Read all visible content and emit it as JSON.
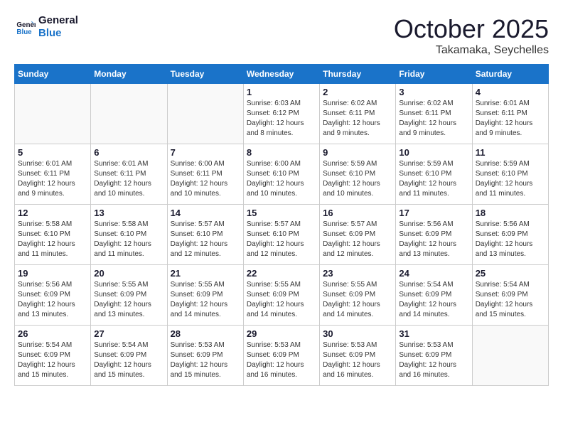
{
  "header": {
    "logo_text_general": "General",
    "logo_text_blue": "Blue",
    "month": "October 2025",
    "location": "Takamaka, Seychelles"
  },
  "weekdays": [
    "Sunday",
    "Monday",
    "Tuesday",
    "Wednesday",
    "Thursday",
    "Friday",
    "Saturday"
  ],
  "weeks": [
    [
      {
        "day": "",
        "sunrise": "",
        "sunset": "",
        "daylight": ""
      },
      {
        "day": "",
        "sunrise": "",
        "sunset": "",
        "daylight": ""
      },
      {
        "day": "",
        "sunrise": "",
        "sunset": "",
        "daylight": ""
      },
      {
        "day": "1",
        "sunrise": "Sunrise: 6:03 AM",
        "sunset": "Sunset: 6:12 PM",
        "daylight": "Daylight: 12 hours and 8 minutes."
      },
      {
        "day": "2",
        "sunrise": "Sunrise: 6:02 AM",
        "sunset": "Sunset: 6:11 PM",
        "daylight": "Daylight: 12 hours and 9 minutes."
      },
      {
        "day": "3",
        "sunrise": "Sunrise: 6:02 AM",
        "sunset": "Sunset: 6:11 PM",
        "daylight": "Daylight: 12 hours and 9 minutes."
      },
      {
        "day": "4",
        "sunrise": "Sunrise: 6:01 AM",
        "sunset": "Sunset: 6:11 PM",
        "daylight": "Daylight: 12 hours and 9 minutes."
      }
    ],
    [
      {
        "day": "5",
        "sunrise": "Sunrise: 6:01 AM",
        "sunset": "Sunset: 6:11 PM",
        "daylight": "Daylight: 12 hours and 9 minutes."
      },
      {
        "day": "6",
        "sunrise": "Sunrise: 6:01 AM",
        "sunset": "Sunset: 6:11 PM",
        "daylight": "Daylight: 12 hours and 10 minutes."
      },
      {
        "day": "7",
        "sunrise": "Sunrise: 6:00 AM",
        "sunset": "Sunset: 6:11 PM",
        "daylight": "Daylight: 12 hours and 10 minutes."
      },
      {
        "day": "8",
        "sunrise": "Sunrise: 6:00 AM",
        "sunset": "Sunset: 6:10 PM",
        "daylight": "Daylight: 12 hours and 10 minutes."
      },
      {
        "day": "9",
        "sunrise": "Sunrise: 5:59 AM",
        "sunset": "Sunset: 6:10 PM",
        "daylight": "Daylight: 12 hours and 10 minutes."
      },
      {
        "day": "10",
        "sunrise": "Sunrise: 5:59 AM",
        "sunset": "Sunset: 6:10 PM",
        "daylight": "Daylight: 12 hours and 11 minutes."
      },
      {
        "day": "11",
        "sunrise": "Sunrise: 5:59 AM",
        "sunset": "Sunset: 6:10 PM",
        "daylight": "Daylight: 12 hours and 11 minutes."
      }
    ],
    [
      {
        "day": "12",
        "sunrise": "Sunrise: 5:58 AM",
        "sunset": "Sunset: 6:10 PM",
        "daylight": "Daylight: 12 hours and 11 minutes."
      },
      {
        "day": "13",
        "sunrise": "Sunrise: 5:58 AM",
        "sunset": "Sunset: 6:10 PM",
        "daylight": "Daylight: 12 hours and 11 minutes."
      },
      {
        "day": "14",
        "sunrise": "Sunrise: 5:57 AM",
        "sunset": "Sunset: 6:10 PM",
        "daylight": "Daylight: 12 hours and 12 minutes."
      },
      {
        "day": "15",
        "sunrise": "Sunrise: 5:57 AM",
        "sunset": "Sunset: 6:10 PM",
        "daylight": "Daylight: 12 hours and 12 minutes."
      },
      {
        "day": "16",
        "sunrise": "Sunrise: 5:57 AM",
        "sunset": "Sunset: 6:09 PM",
        "daylight": "Daylight: 12 hours and 12 minutes."
      },
      {
        "day": "17",
        "sunrise": "Sunrise: 5:56 AM",
        "sunset": "Sunset: 6:09 PM",
        "daylight": "Daylight: 12 hours and 13 minutes."
      },
      {
        "day": "18",
        "sunrise": "Sunrise: 5:56 AM",
        "sunset": "Sunset: 6:09 PM",
        "daylight": "Daylight: 12 hours and 13 minutes."
      }
    ],
    [
      {
        "day": "19",
        "sunrise": "Sunrise: 5:56 AM",
        "sunset": "Sunset: 6:09 PM",
        "daylight": "Daylight: 12 hours and 13 minutes."
      },
      {
        "day": "20",
        "sunrise": "Sunrise: 5:55 AM",
        "sunset": "Sunset: 6:09 PM",
        "daylight": "Daylight: 12 hours and 13 minutes."
      },
      {
        "day": "21",
        "sunrise": "Sunrise: 5:55 AM",
        "sunset": "Sunset: 6:09 PM",
        "daylight": "Daylight: 12 hours and 14 minutes."
      },
      {
        "day": "22",
        "sunrise": "Sunrise: 5:55 AM",
        "sunset": "Sunset: 6:09 PM",
        "daylight": "Daylight: 12 hours and 14 minutes."
      },
      {
        "day": "23",
        "sunrise": "Sunrise: 5:55 AM",
        "sunset": "Sunset: 6:09 PM",
        "daylight": "Daylight: 12 hours and 14 minutes."
      },
      {
        "day": "24",
        "sunrise": "Sunrise: 5:54 AM",
        "sunset": "Sunset: 6:09 PM",
        "daylight": "Daylight: 12 hours and 14 minutes."
      },
      {
        "day": "25",
        "sunrise": "Sunrise: 5:54 AM",
        "sunset": "Sunset: 6:09 PM",
        "daylight": "Daylight: 12 hours and 15 minutes."
      }
    ],
    [
      {
        "day": "26",
        "sunrise": "Sunrise: 5:54 AM",
        "sunset": "Sunset: 6:09 PM",
        "daylight": "Daylight: 12 hours and 15 minutes."
      },
      {
        "day": "27",
        "sunrise": "Sunrise: 5:54 AM",
        "sunset": "Sunset: 6:09 PM",
        "daylight": "Daylight: 12 hours and 15 minutes."
      },
      {
        "day": "28",
        "sunrise": "Sunrise: 5:53 AM",
        "sunset": "Sunset: 6:09 PM",
        "daylight": "Daylight: 12 hours and 15 minutes."
      },
      {
        "day": "29",
        "sunrise": "Sunrise: 5:53 AM",
        "sunset": "Sunset: 6:09 PM",
        "daylight": "Daylight: 12 hours and 16 minutes."
      },
      {
        "day": "30",
        "sunrise": "Sunrise: 5:53 AM",
        "sunset": "Sunset: 6:09 PM",
        "daylight": "Daylight: 12 hours and 16 minutes."
      },
      {
        "day": "31",
        "sunrise": "Sunrise: 5:53 AM",
        "sunset": "Sunset: 6:09 PM",
        "daylight": "Daylight: 12 hours and 16 minutes."
      },
      {
        "day": "",
        "sunrise": "",
        "sunset": "",
        "daylight": ""
      }
    ]
  ]
}
